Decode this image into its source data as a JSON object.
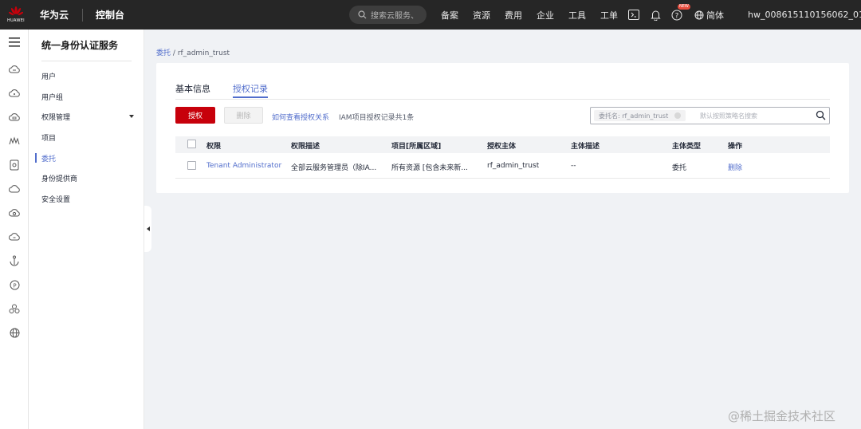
{
  "topbar": {
    "logo_text": "HUAWEI",
    "brand": "华为云",
    "console": "控制台",
    "search_placeholder": "搜索云服务、",
    "nav": [
      "备案",
      "资源",
      "费用",
      "企业",
      "工具",
      "工单"
    ],
    "badge": "NEW",
    "language": "简体",
    "account": "hw_008615110156062_01",
    "brand_color": "#c7000b"
  },
  "rail_icons": [
    "menu-icon",
    "cloud-server-icon",
    "cloud-icon",
    "cloud-database-icon",
    "monitor-icon",
    "storage-icon",
    "cloud-outline-icon",
    "cloud-upload-icon",
    "cloud-sync-icon",
    "anchor-icon",
    "parking-icon",
    "cluster-icon",
    "globe-icon"
  ],
  "submenu": {
    "title": "统一身份认证服务",
    "items": [
      {
        "label": "用户"
      },
      {
        "label": "用户组"
      },
      {
        "label": "权限管理"
      },
      {
        "label": "项目"
      },
      {
        "label": "委托"
      },
      {
        "label": "身份提供商"
      },
      {
        "label": "安全设置"
      }
    ]
  },
  "breadcrumb": {
    "parent": "委托",
    "separator": "/",
    "current": "rf_admin_trust"
  },
  "tabs": [
    {
      "label": "基本信息"
    },
    {
      "label": "授权记录"
    }
  ],
  "toolbar": {
    "authorize_label": "授权",
    "delete_label": "删除",
    "howto_link": "如何查看授权关系",
    "count_text": "IAM项目授权记录共1条"
  },
  "filter": {
    "chip": "委托名: rf_admin_trust",
    "placeholder": "默认按照策略名搜索"
  },
  "table": {
    "headers": [
      "权限",
      "权限描述",
      "项目[所属区域]",
      "授权主体",
      "主体描述",
      "主体类型",
      "操作"
    ],
    "rows": [
      {
        "permission": "Tenant Administrator",
        "description": "全部云服务管理员（除IA...",
        "project": "所有资源 [包含未来新...",
        "principal": "rf_admin_trust",
        "principal_desc": "--",
        "principal_type": "委托",
        "action": "删除"
      }
    ]
  },
  "watermark": "@稀土掘金技术社区"
}
